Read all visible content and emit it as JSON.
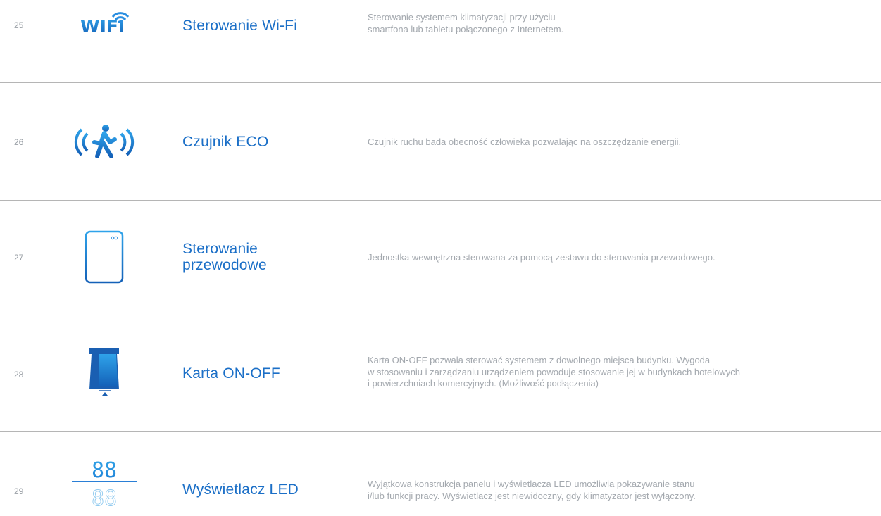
{
  "rows": [
    {
      "number": "25",
      "icon": "wifi-logo-icon",
      "icon_text": "WIFI",
      "title": [
        "Sterowanie Wi-Fi"
      ],
      "desc": [
        "Sterowanie systemem klimatyzacji przy użyciu",
        "smartfona lub tabletu połączonego z Internetem."
      ]
    },
    {
      "number": "26",
      "icon": "motion-sensor-icon",
      "title": [
        "Czujnik ECO"
      ],
      "desc": [
        "Czujnik ruchu bada obecność człowieka pozwalając na oszczędzanie energii."
      ]
    },
    {
      "number": "27",
      "icon": "wired-controller-icon",
      "title": [
        "Sterowanie",
        "przewodowe"
      ],
      "desc": [
        "Jednostka wewnętrzna sterowana za pomocą zestawu do sterowania przewodowego."
      ]
    },
    {
      "number": "28",
      "icon": "key-card-icon",
      "title": [
        "Karta ON-OFF"
      ],
      "desc": [
        "Karta ON-OFF pozwala sterować systemem z dowolnego miejsca budynku. Wygoda",
        "w stosowaniu i zarządzaniu urządzeniem powoduje stosowanie jej w budynkach hotelowych",
        "i powierzchniach komercyjnych. (Możliwość podłączenia)"
      ]
    },
    {
      "number": "29",
      "icon": "led-display-icon",
      "icon_text": "88",
      "title": [
        "Wyświetlacz LED"
      ],
      "desc": [
        "Wyjątkowa konstrukcja panelu i wyświetlacza LED umożliwia pokazywanie stanu",
        "i/lub funkcji pracy. Wyświetlacz jest niewidoczny, gdy klimatyzator jest wyłączony."
      ]
    }
  ],
  "colors": {
    "accent": "#1b6fc7",
    "accent_light": "#33a6e8",
    "text_muted": "#a3a8ae",
    "separator": "#b5b5b5"
  }
}
